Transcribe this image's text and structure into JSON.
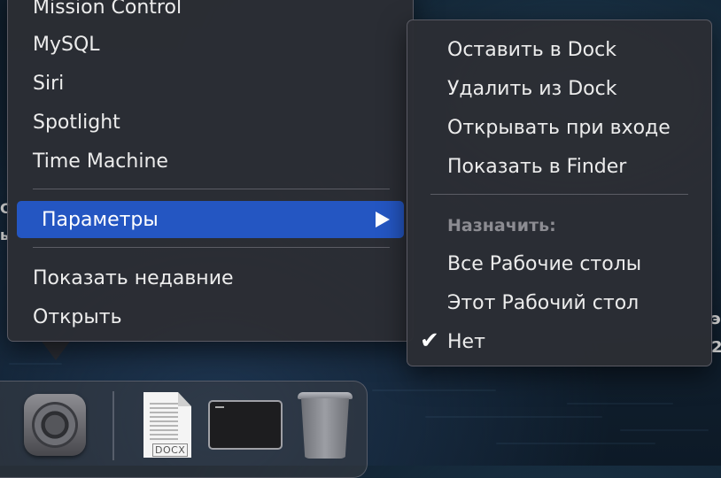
{
  "main_menu": {
    "items": [
      "Mission Control",
      "MySQL",
      "Siri",
      "Spotlight",
      "Time Machine"
    ],
    "options_label": "Параметры",
    "recent_label": "Показать недавние",
    "open_label": "Открыть"
  },
  "submenu": {
    "items": [
      "Оставить в Dock",
      "Удалить из Dock",
      "Открывать при входе",
      "Показать в Finder"
    ],
    "assign_heading": "Назначить:",
    "assign_options": [
      "Все Рабочие столы",
      "Этот Рабочий стол",
      "Нет"
    ],
    "checked_option": "Нет",
    "check_mark": "✔"
  },
  "dock": {
    "items": [
      "system-preferences",
      "docx-document",
      "terminal-window",
      "trash"
    ],
    "docx_label": "DOCX"
  },
  "background_edge_text": [
    "С",
    "ь",
    "э",
    "2"
  ],
  "colors": {
    "selection": "#2456c2",
    "menu_background": "#2c2e34"
  }
}
